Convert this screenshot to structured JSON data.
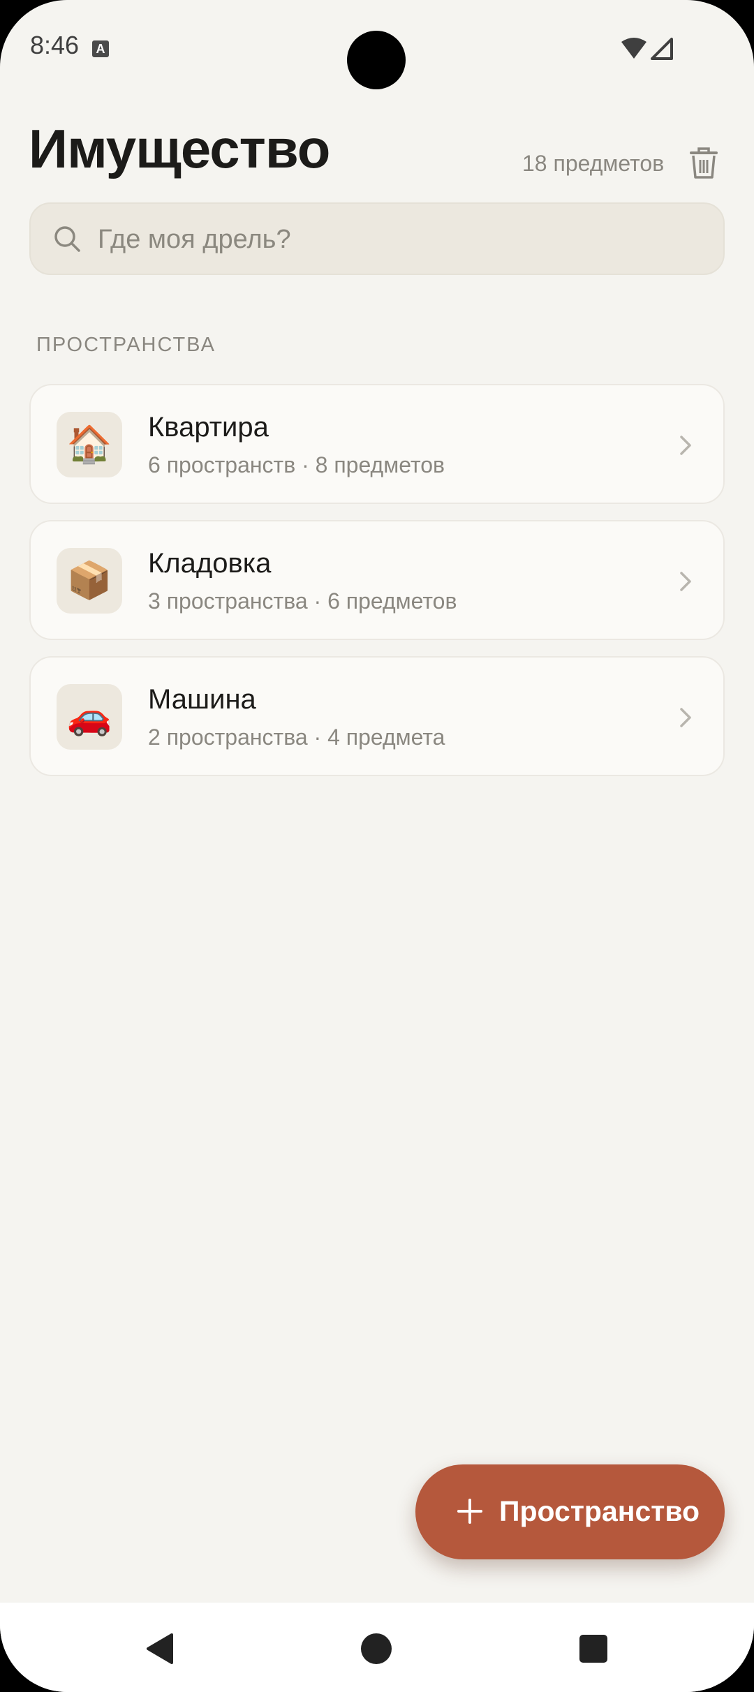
{
  "status_bar": {
    "time": "8:46"
  },
  "header": {
    "title": "Имущество",
    "item_count": "18 предметов"
  },
  "search": {
    "placeholder": "Где моя дрель?",
    "value": ""
  },
  "spaces_section": {
    "label": "ПРОСТРАНСТВА",
    "items": [
      {
        "name": "Квартира",
        "meta": "6 пространств · 8 предметов",
        "emoji": "🏠",
        "icon": "house-icon"
      },
      {
        "name": "Кладовка",
        "meta": "3 пространства · 6 предметов",
        "emoji": "📦",
        "icon": "package-icon"
      },
      {
        "name": "Машина",
        "meta": "2 пространства · 4 предмета",
        "emoji": "🚗",
        "icon": "car-icon"
      }
    ]
  },
  "fab": {
    "label": "Пространство"
  },
  "colors": {
    "background": "#f5f4f0",
    "accent": "#b5583c",
    "card": "#fbfaf7"
  }
}
